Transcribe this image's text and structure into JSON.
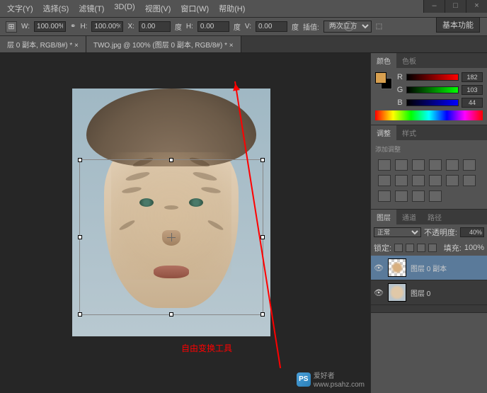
{
  "menu": {
    "text": "文字(Y)",
    "select": "选择(S)",
    "filter": "滤镜(T)",
    "threed": "3D(D)",
    "view": "视图(V)",
    "window": "窗口(W)",
    "help": "帮助(H)"
  },
  "winctrl": {
    "min": "–",
    "max": "□",
    "close": "×"
  },
  "basic": {
    "label": "基本功能"
  },
  "opt": {
    "w_label": "W:",
    "w_val": "100.00%",
    "link": "⚭",
    "h_label": "H:",
    "h_val": "100.00%",
    "x_label": "X:",
    "x_val": "0.00",
    "deg1": "度",
    "hh_label": "H:",
    "hh_val": "0.00",
    "deg2": "度",
    "v_label": "V:",
    "v_val": "0.00",
    "deg3": "度",
    "interp_label": "插值:",
    "interp_val": "两次立方"
  },
  "tabs": {
    "t1": "层 0 副本, RGB/8#) * ×",
    "t2": "TWO.jpg @ 100% (图层 0 副本, RGB/8#) * ×"
  },
  "annotation": "自由变换工具",
  "watermark": {
    "logo": "PS",
    "text": "爱好者",
    "url": "www.psahz.com"
  },
  "panels": {
    "color": {
      "tab1": "颜色",
      "tab2": "色板",
      "r": "R",
      "g": "G",
      "b": "B",
      "r_val": "182",
      "g_val": "103",
      "b_val": "44"
    },
    "adjust": {
      "tab1": "调整",
      "tab2": "样式",
      "add": "添加调整"
    },
    "layers": {
      "tab1": "图层",
      "tab2": "通道",
      "tab3": "路径",
      "blend": "正常",
      "opacity_label": "不透明度:",
      "opacity": "40%",
      "lock_label": "锁定:",
      "fill_label": "填充:",
      "fill": "100%",
      "l1": "图层 0 副本",
      "l2": "图层 0",
      "eye": "👁"
    }
  }
}
